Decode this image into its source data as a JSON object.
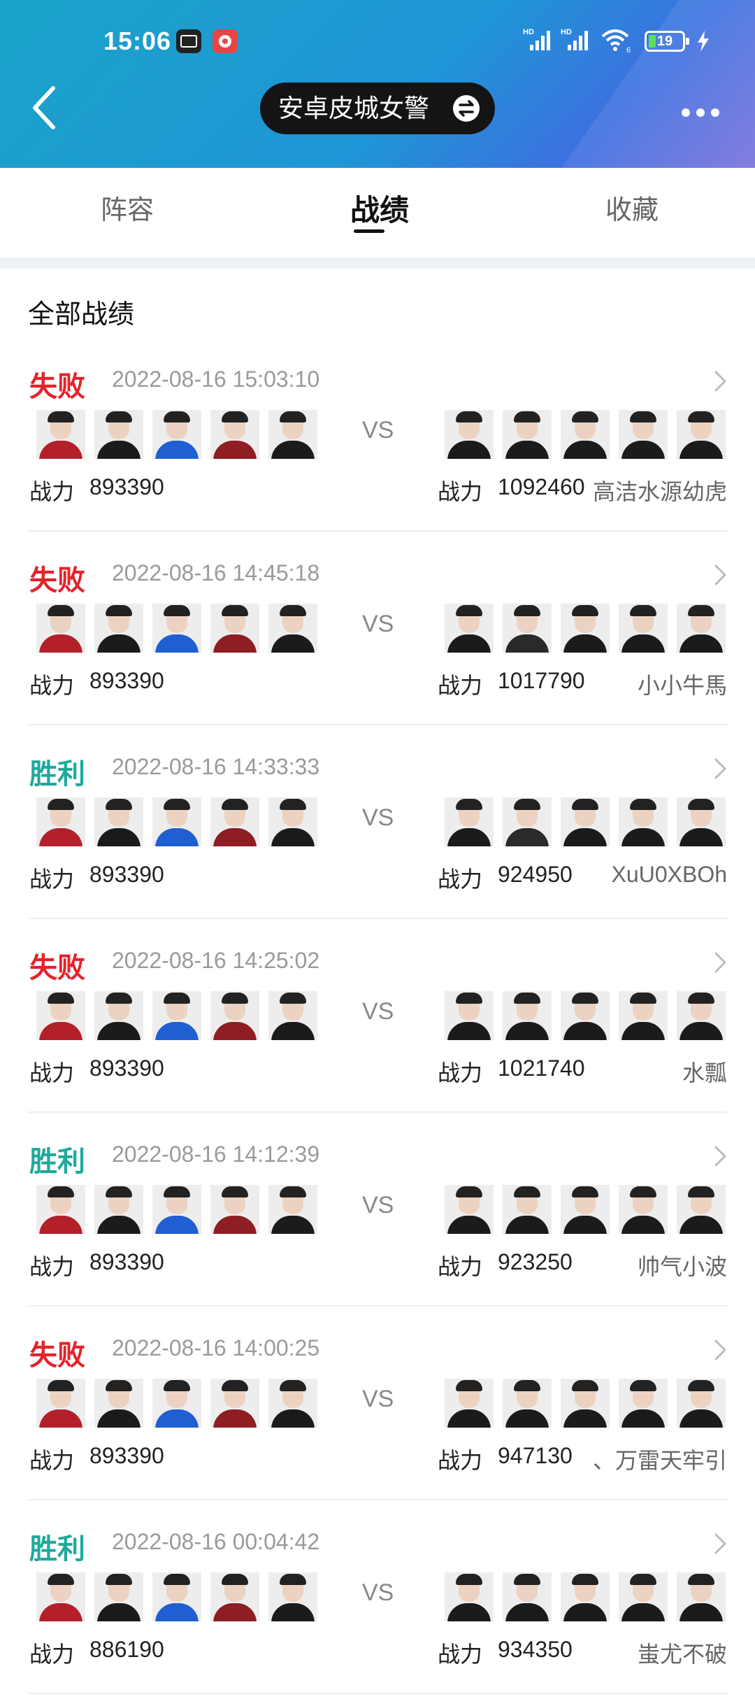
{
  "status_bar": {
    "time": "15:06",
    "battery": "19",
    "wifi_badge": "6"
  },
  "header": {
    "account_name": "安卓皮城女警"
  },
  "tabs": [
    {
      "label": "阵容",
      "active": false
    },
    {
      "label": "战绩",
      "active": true
    },
    {
      "label": "收藏",
      "active": false
    }
  ],
  "section_title": "全部战绩",
  "colors": {
    "win": "#1fa99b",
    "loss": "#e5222b"
  },
  "power_label": "战力",
  "vs_label": "VS",
  "matches": [
    {
      "result": "失败",
      "outcome": "loss",
      "time": "2022-08-16 15:03:10",
      "my_power": "893390",
      "opp_power": "1092460",
      "opp_name": "高洁水源幼虎"
    },
    {
      "result": "失败",
      "outcome": "loss",
      "time": "2022-08-16 14:45:18",
      "my_power": "893390",
      "opp_power": "1017790",
      "opp_name": "小小牛馬"
    },
    {
      "result": "胜利",
      "outcome": "win",
      "time": "2022-08-16 14:33:33",
      "my_power": "893390",
      "opp_power": "924950",
      "opp_name": "XuU0XBOh"
    },
    {
      "result": "失败",
      "outcome": "loss",
      "time": "2022-08-16 14:25:02",
      "my_power": "893390",
      "opp_power": "1021740",
      "opp_name": "水瓢"
    },
    {
      "result": "胜利",
      "outcome": "win",
      "time": "2022-08-16 14:12:39",
      "my_power": "893390",
      "opp_power": "923250",
      "opp_name": "帅气小波"
    },
    {
      "result": "失败",
      "outcome": "loss",
      "time": "2022-08-16 14:00:25",
      "my_power": "893390",
      "opp_power": "947130",
      "opp_name": "、万雷天牢引"
    },
    {
      "result": "胜利",
      "outcome": "win",
      "time": "2022-08-16 00:04:42",
      "my_power": "886190",
      "opp_power": "934350",
      "opp_name": "蚩尤不破"
    }
  ]
}
